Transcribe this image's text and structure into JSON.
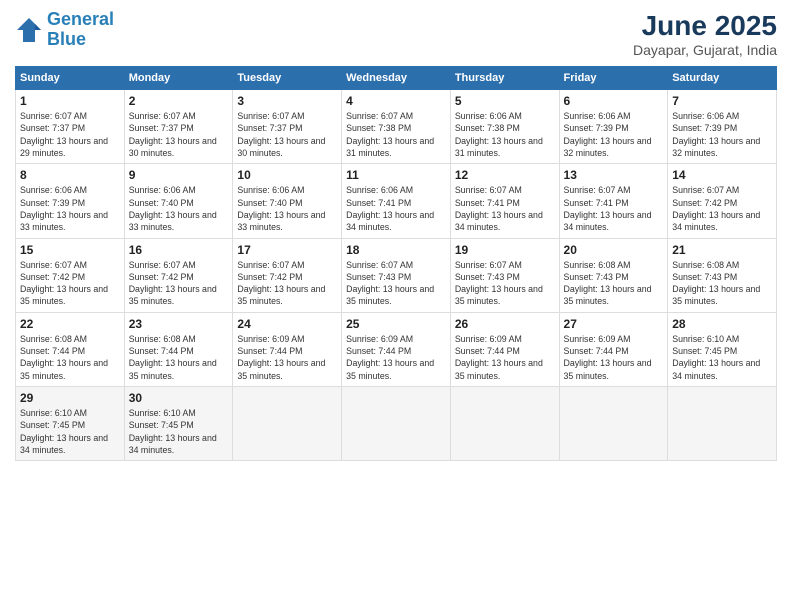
{
  "logo": {
    "line1": "General",
    "line2": "Blue"
  },
  "title": "June 2025",
  "location": "Dayapar, Gujarat, India",
  "columns": [
    "Sunday",
    "Monday",
    "Tuesday",
    "Wednesday",
    "Thursday",
    "Friday",
    "Saturday"
  ],
  "weeks": [
    [
      {
        "day": "1",
        "sunrise": "6:07 AM",
        "sunset": "7:37 PM",
        "daylight": "13 hours and 29 minutes."
      },
      {
        "day": "2",
        "sunrise": "6:07 AM",
        "sunset": "7:37 PM",
        "daylight": "13 hours and 30 minutes."
      },
      {
        "day": "3",
        "sunrise": "6:07 AM",
        "sunset": "7:37 PM",
        "daylight": "13 hours and 30 minutes."
      },
      {
        "day": "4",
        "sunrise": "6:07 AM",
        "sunset": "7:38 PM",
        "daylight": "13 hours and 31 minutes."
      },
      {
        "day": "5",
        "sunrise": "6:06 AM",
        "sunset": "7:38 PM",
        "daylight": "13 hours and 31 minutes."
      },
      {
        "day": "6",
        "sunrise": "6:06 AM",
        "sunset": "7:39 PM",
        "daylight": "13 hours and 32 minutes."
      },
      {
        "day": "7",
        "sunrise": "6:06 AM",
        "sunset": "7:39 PM",
        "daylight": "13 hours and 32 minutes."
      }
    ],
    [
      {
        "day": "8",
        "sunrise": "6:06 AM",
        "sunset": "7:39 PM",
        "daylight": "13 hours and 33 minutes."
      },
      {
        "day": "9",
        "sunrise": "6:06 AM",
        "sunset": "7:40 PM",
        "daylight": "13 hours and 33 minutes."
      },
      {
        "day": "10",
        "sunrise": "6:06 AM",
        "sunset": "7:40 PM",
        "daylight": "13 hours and 33 minutes."
      },
      {
        "day": "11",
        "sunrise": "6:06 AM",
        "sunset": "7:41 PM",
        "daylight": "13 hours and 34 minutes."
      },
      {
        "day": "12",
        "sunrise": "6:07 AM",
        "sunset": "7:41 PM",
        "daylight": "13 hours and 34 minutes."
      },
      {
        "day": "13",
        "sunrise": "6:07 AM",
        "sunset": "7:41 PM",
        "daylight": "13 hours and 34 minutes."
      },
      {
        "day": "14",
        "sunrise": "6:07 AM",
        "sunset": "7:42 PM",
        "daylight": "13 hours and 34 minutes."
      }
    ],
    [
      {
        "day": "15",
        "sunrise": "6:07 AM",
        "sunset": "7:42 PM",
        "daylight": "13 hours and 35 minutes."
      },
      {
        "day": "16",
        "sunrise": "6:07 AM",
        "sunset": "7:42 PM",
        "daylight": "13 hours and 35 minutes."
      },
      {
        "day": "17",
        "sunrise": "6:07 AM",
        "sunset": "7:42 PM",
        "daylight": "13 hours and 35 minutes."
      },
      {
        "day": "18",
        "sunrise": "6:07 AM",
        "sunset": "7:43 PM",
        "daylight": "13 hours and 35 minutes."
      },
      {
        "day": "19",
        "sunrise": "6:07 AM",
        "sunset": "7:43 PM",
        "daylight": "13 hours and 35 minutes."
      },
      {
        "day": "20",
        "sunrise": "6:08 AM",
        "sunset": "7:43 PM",
        "daylight": "13 hours and 35 minutes."
      },
      {
        "day": "21",
        "sunrise": "6:08 AM",
        "sunset": "7:43 PM",
        "daylight": "13 hours and 35 minutes."
      }
    ],
    [
      {
        "day": "22",
        "sunrise": "6:08 AM",
        "sunset": "7:44 PM",
        "daylight": "13 hours and 35 minutes."
      },
      {
        "day": "23",
        "sunrise": "6:08 AM",
        "sunset": "7:44 PM",
        "daylight": "13 hours and 35 minutes."
      },
      {
        "day": "24",
        "sunrise": "6:09 AM",
        "sunset": "7:44 PM",
        "daylight": "13 hours and 35 minutes."
      },
      {
        "day": "25",
        "sunrise": "6:09 AM",
        "sunset": "7:44 PM",
        "daylight": "13 hours and 35 minutes."
      },
      {
        "day": "26",
        "sunrise": "6:09 AM",
        "sunset": "7:44 PM",
        "daylight": "13 hours and 35 minutes."
      },
      {
        "day": "27",
        "sunrise": "6:09 AM",
        "sunset": "7:44 PM",
        "daylight": "13 hours and 35 minutes."
      },
      {
        "day": "28",
        "sunrise": "6:10 AM",
        "sunset": "7:45 PM",
        "daylight": "13 hours and 34 minutes."
      }
    ],
    [
      {
        "day": "29",
        "sunrise": "6:10 AM",
        "sunset": "7:45 PM",
        "daylight": "13 hours and 34 minutes."
      },
      {
        "day": "30",
        "sunrise": "6:10 AM",
        "sunset": "7:45 PM",
        "daylight": "13 hours and 34 minutes."
      },
      null,
      null,
      null,
      null,
      null
    ]
  ]
}
